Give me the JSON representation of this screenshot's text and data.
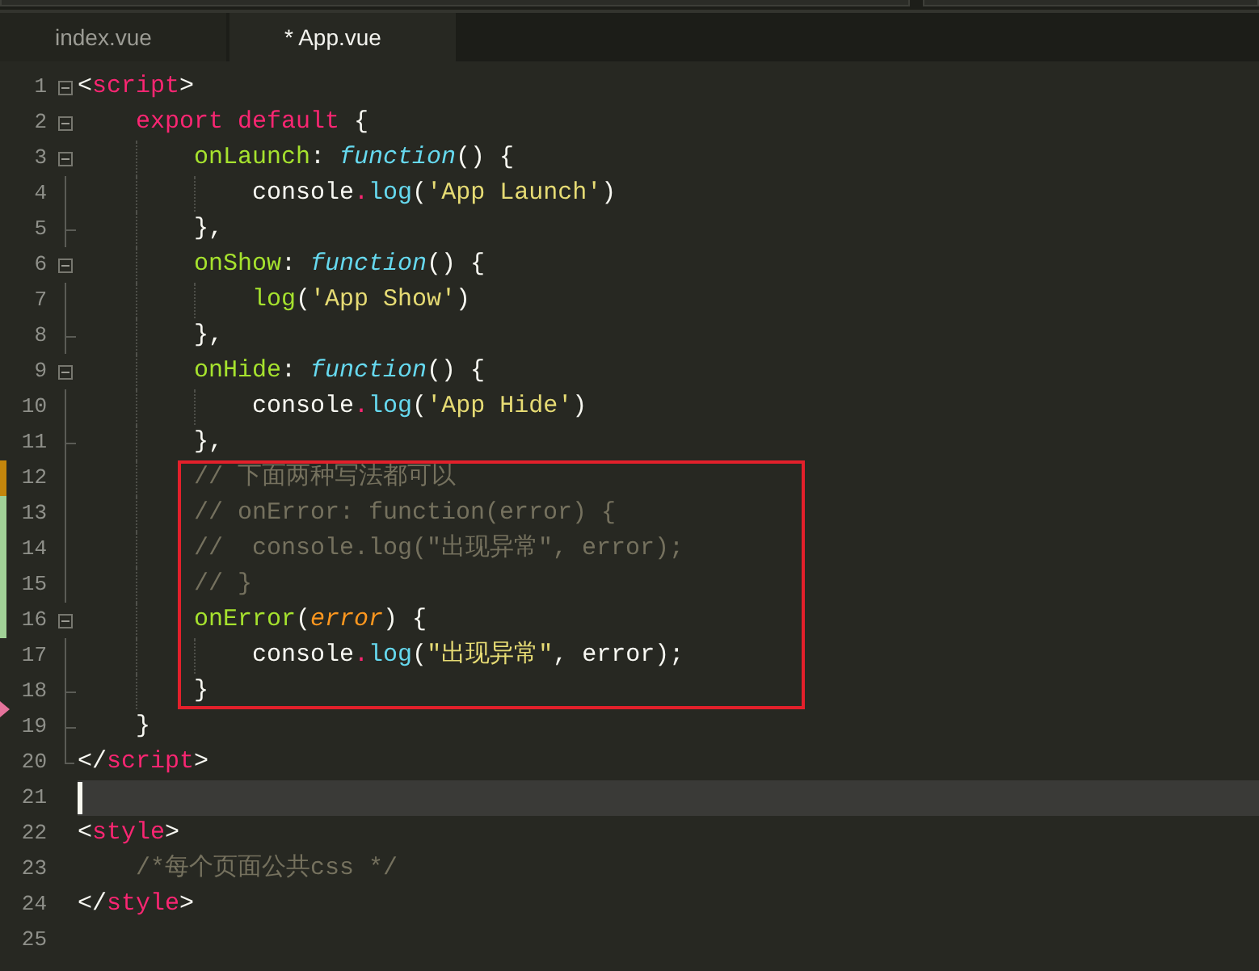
{
  "tabs": [
    {
      "label": "index.vue",
      "selected": false
    },
    {
      "label": "* App.vue",
      "selected": true
    }
  ],
  "lines": [
    {
      "number": "1",
      "kind": "plain",
      "current": false,
      "expanded": true,
      "tokens": [
        {
          "kind": "punct",
          "text": "<"
        },
        {
          "kind": "tag",
          "text": "script"
        },
        {
          "kind": "punct",
          "text": ">"
        }
      ],
      "children": [
        {
          "number": "2",
          "kind": "plain",
          "current": false,
          "expanded": true,
          "tokens": [
            {
              "kind": "keyword",
              "text": "export default"
            },
            {
              "kind": "plain",
              "text": " {"
            }
          ],
          "children": [
            {
              "number": "3",
              "kind": "plain",
              "current": false,
              "expanded": true,
              "tokens": [
                {
                  "kind": "key",
                  "text": "onLaunch"
                },
                {
                  "kind": "plain",
                  "text": ": "
                },
                {
                  "kind": "storage",
                  "text": "function"
                },
                {
                  "kind": "plain",
                  "text": "() {"
                }
              ],
              "children": [
                {
                  "number": "4",
                  "kind": "plain",
                  "current": false,
                  "tokens": [
                    {
                      "kind": "plain",
                      "text": "console"
                    },
                    {
                      "kind": "operator",
                      "text": "."
                    },
                    {
                      "kind": "support",
                      "text": "log"
                    },
                    {
                      "kind": "plain",
                      "text": "("
                    },
                    {
                      "kind": "string",
                      "text": "'App Launch'"
                    },
                    {
                      "kind": "plain",
                      "text": ")"
                    }
                  ]
                }
              ]
            },
            {
              "number": "5",
              "kind": "plain",
              "current": false,
              "tokens": [
                {
                  "kind": "plain",
                  "text": "},"
                }
              ]
            },
            {
              "number": "6",
              "kind": "plain",
              "current": false,
              "expanded": true,
              "tokens": [
                {
                  "kind": "key",
                  "text": "onShow"
                },
                {
                  "kind": "plain",
                  "text": ": "
                },
                {
                  "kind": "storage",
                  "text": "function"
                },
                {
                  "kind": "plain",
                  "text": "() {"
                }
              ],
              "children": [
                {
                  "number": "7",
                  "kind": "plain",
                  "current": false,
                  "tokens": [
                    {
                      "kind": "call",
                      "text": "log"
                    },
                    {
                      "kind": "plain",
                      "text": "("
                    },
                    {
                      "kind": "string",
                      "text": "'App Show'"
                    },
                    {
                      "kind": "plain",
                      "text": ")"
                    }
                  ]
                }
              ]
            },
            {
              "number": "8",
              "kind": "plain",
              "current": false,
              "tokens": [
                {
                  "kind": "plain",
                  "text": "},"
                }
              ]
            },
            {
              "number": "9",
              "kind": "plain",
              "current": false,
              "expanded": true,
              "tokens": [
                {
                  "kind": "key",
                  "text": "onHide"
                },
                {
                  "kind": "plain",
                  "text": ": "
                },
                {
                  "kind": "storage",
                  "text": "function"
                },
                {
                  "kind": "plain",
                  "text": "() {"
                }
              ],
              "children": [
                {
                  "number": "10",
                  "kind": "plain",
                  "current": false,
                  "tokens": [
                    {
                      "kind": "plain",
                      "text": "console"
                    },
                    {
                      "kind": "operator",
                      "text": "."
                    },
                    {
                      "kind": "support",
                      "text": "log"
                    },
                    {
                      "kind": "plain",
                      "text": "("
                    },
                    {
                      "kind": "string",
                      "text": "'App Hide'"
                    },
                    {
                      "kind": "plain",
                      "text": ")"
                    }
                  ]
                }
              ]
            },
            {
              "number": "11",
              "kind": "plain",
              "current": false,
              "tokens": [
                {
                  "kind": "plain",
                  "text": "},"
                }
              ]
            },
            {
              "kind": "annotation",
              "children": [
                {
                  "number": "12",
                  "kind": "modified",
                  "current": false,
                  "tokens": [
                    {
                      "kind": "comment",
                      "text": "// 下面两种写法都可以"
                    }
                  ]
                },
                {
                  "number": "13",
                  "kind": "added",
                  "current": false,
                  "tokens": [
                    {
                      "kind": "comment",
                      "text": "// onError: function(error) {"
                    }
                  ]
                },
                {
                  "number": "14",
                  "kind": "added",
                  "current": false,
                  "tokens": [
                    {
                      "kind": "comment",
                      "text": "//  console.log(\"出现异常\", error);"
                    }
                  ]
                },
                {
                  "number": "15",
                  "kind": "added",
                  "current": false,
                  "tokens": [
                    {
                      "kind": "comment",
                      "text": "// }"
                    }
                  ]
                },
                {
                  "number": "16",
                  "kind": "added",
                  "current": false,
                  "expanded": true,
                  "tokens": [
                    {
                      "kind": "key",
                      "text": "onError"
                    },
                    {
                      "kind": "plain",
                      "text": "("
                    },
                    {
                      "kind": "param",
                      "text": "error"
                    },
                    {
                      "kind": "plain",
                      "text": ") {"
                    }
                  ],
                  "children": [
                    {
                      "number": "17",
                      "kind": "plain",
                      "current": false,
                      "tokens": [
                        {
                          "kind": "plain",
                          "text": "console"
                        },
                        {
                          "kind": "operator",
                          "text": "."
                        },
                        {
                          "kind": "support",
                          "text": "log"
                        },
                        {
                          "kind": "plain",
                          "text": "("
                        },
                        {
                          "kind": "string",
                          "text": "\"出现异常\""
                        },
                        {
                          "kind": "plain",
                          "text": ", error);"
                        }
                      ]
                    }
                  ]
                },
                {
                  "number": "18",
                  "kind": "deleted",
                  "current": false,
                  "tokens": [
                    {
                      "kind": "plain",
                      "text": "}"
                    }
                  ]
                }
              ]
            }
          ]
        },
        {
          "number": "19",
          "kind": "plain",
          "current": false,
          "tokens": [
            {
              "kind": "plain",
              "text": "}"
            }
          ]
        }
      ]
    },
    {
      "number": "20",
      "kind": "plain",
      "current": false,
      "tokens": [
        {
          "kind": "punct",
          "text": "</"
        },
        {
          "kind": "tag",
          "text": "script"
        },
        {
          "kind": "punct",
          "text": ">"
        }
      ]
    },
    {
      "number": "21",
      "kind": "plain",
      "current": true
    },
    {
      "number": "22",
      "kind": "plain",
      "current": false,
      "tokens": [
        {
          "kind": "punct",
          "text": "<"
        },
        {
          "kind": "tag",
          "text": "style"
        },
        {
          "kind": "punct",
          "text": ">"
        }
      ],
      "children": [
        {
          "number": "23",
          "kind": "plain",
          "current": false,
          "tokens": [
            {
              "kind": "comment",
              "text": "/*每个页面公共css */"
            }
          ]
        }
      ]
    },
    {
      "number": "24",
      "kind": "plain",
      "current": false,
      "tokens": [
        {
          "kind": "punct",
          "text": "</"
        },
        {
          "kind": "tag",
          "text": "style"
        },
        {
          "kind": "punct",
          "text": ">"
        }
      ]
    },
    {
      "number": "25",
      "kind": "plain",
      "current": false
    }
  ]
}
